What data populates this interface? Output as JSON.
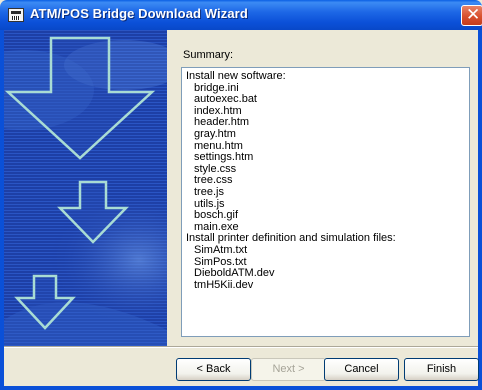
{
  "window": {
    "title": "ATM/POS Bridge Download Wizard"
  },
  "summary": {
    "label": "Summary:",
    "lines": [
      {
        "text": "Install new software:",
        "kind": "heading"
      },
      {
        "text": "bridge.ini",
        "kind": "file"
      },
      {
        "text": "autoexec.bat",
        "kind": "file"
      },
      {
        "text": "index.htm",
        "kind": "file"
      },
      {
        "text": "header.htm",
        "kind": "file"
      },
      {
        "text": "gray.htm",
        "kind": "file"
      },
      {
        "text": "menu.htm",
        "kind": "file"
      },
      {
        "text": "settings.htm",
        "kind": "file"
      },
      {
        "text": "style.css",
        "kind": "file"
      },
      {
        "text": "tree.css",
        "kind": "file"
      },
      {
        "text": "tree.js",
        "kind": "file"
      },
      {
        "text": "utils.js",
        "kind": "file"
      },
      {
        "text": "bosch.gif",
        "kind": "file"
      },
      {
        "text": "main.exe",
        "kind": "file"
      },
      {
        "text": "Install printer definition and simulation files:",
        "kind": "heading"
      },
      {
        "text": "SimAtm.txt",
        "kind": "file"
      },
      {
        "text": "SimPos.txt",
        "kind": "file"
      },
      {
        "text": "DieboldATM.dev",
        "kind": "file"
      },
      {
        "text": "tmH5Kii.dev",
        "kind": "file"
      }
    ]
  },
  "buttons": {
    "back": "< Back",
    "next": "Next >",
    "cancel": "Cancel",
    "finish": "Finish"
  },
  "icons": {
    "app": "atm-terminal-icon",
    "close": "close-icon",
    "banner": "down-arrow-graphic"
  },
  "colors": {
    "titlebar": "#0a50d8",
    "close": "#d9502e",
    "banner": "#1c3aa0",
    "arrow_outline": "#a9dcd4",
    "dialog": "#ece9d8"
  }
}
